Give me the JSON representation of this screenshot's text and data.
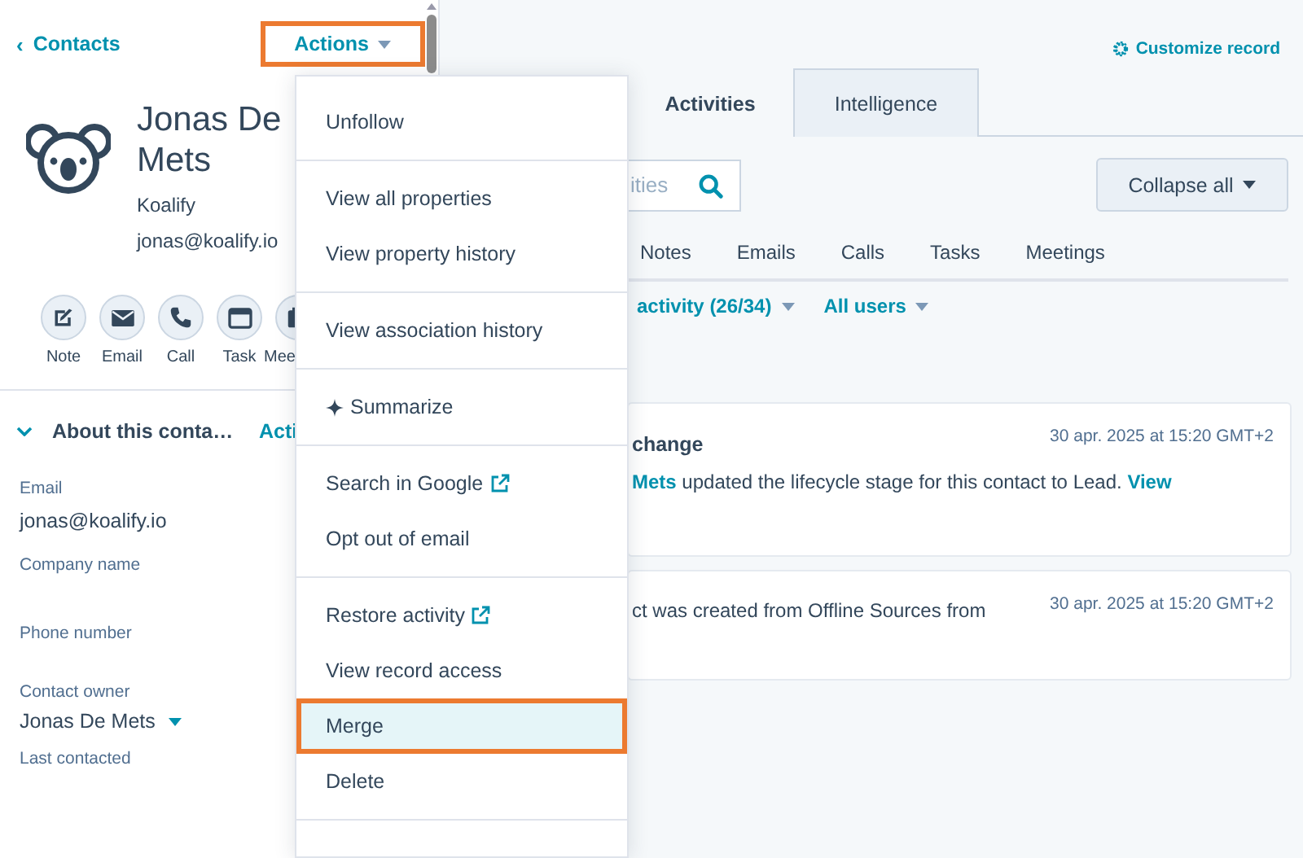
{
  "back_link": {
    "icon": "‹",
    "label": "Contacts"
  },
  "actions_button": {
    "label": "Actions",
    "outlined": true
  },
  "contact": {
    "name": "Jonas De Mets",
    "company": "Koalify",
    "email": "jonas@koalify.io"
  },
  "quick_actions": [
    {
      "kind": "note",
      "label": "Note"
    },
    {
      "kind": "email",
      "label": "Email"
    },
    {
      "kind": "call",
      "label": "Call"
    },
    {
      "kind": "task",
      "label": "Task"
    },
    {
      "kind": "meeting",
      "label": "Mee"
    }
  ],
  "about_section": {
    "title": "About this conta…",
    "expanded": true,
    "action": "Acti"
  },
  "fields": [
    {
      "label": "Email",
      "value": "jonas@koalify.io",
      "kind": "text"
    },
    {
      "label": "Company name",
      "kind": "text"
    },
    {
      "label": "Phone number",
      "kind": "text"
    },
    {
      "label": "Contact owner",
      "value": "Jonas De Mets",
      "kind": "dropdown"
    },
    {
      "label": "Last contacted",
      "kind": "text"
    }
  ],
  "menu": {
    "groups": [
      [
        {
          "label": "Unfollow",
          "kind": "plain",
          "selected": false,
          "outlined": false
        }
      ],
      [
        {
          "label": "View all properties",
          "kind": "plain",
          "selected": false,
          "outlined": false
        },
        {
          "label": "View property history",
          "kind": "plain",
          "selected": false,
          "outlined": false
        }
      ],
      [
        {
          "label": "View association history",
          "kind": "plain",
          "selected": false,
          "outlined": false
        }
      ],
      [
        {
          "label": "Summarize",
          "kind": "ai",
          "selected": false,
          "outlined": false
        }
      ],
      [
        {
          "label": "Search in Google",
          "kind": "external",
          "selected": false,
          "outlined": false
        },
        {
          "label": "Opt out of email",
          "kind": "plain",
          "selected": false,
          "outlined": false
        }
      ],
      [
        {
          "label": "Restore activity",
          "kind": "external",
          "selected": false,
          "outlined": false
        },
        {
          "label": "View record access",
          "kind": "plain",
          "selected": false,
          "outlined": false
        },
        {
          "label": "Merge",
          "kind": "plain",
          "selected": true,
          "outlined": true
        },
        {
          "label": "Delete",
          "kind": "plain",
          "selected": false,
          "outlined": false
        }
      ]
    ]
  },
  "customize_link": "Customize record",
  "tabs": [
    {
      "label": "Activities",
      "selected": true
    },
    {
      "label": "Intelligence",
      "selected": false
    }
  ],
  "search": {
    "placeholder": "ities"
  },
  "collapse_button": "Collapse all",
  "activity_filters": [
    "Notes",
    "Emails",
    "Calls",
    "Tasks",
    "Meetings"
  ],
  "filter_dropdowns": [
    "activity (26/34)",
    "All users"
  ],
  "cards": [
    {
      "title": "change",
      "date": "30 apr. 2025 at 15:20 GMT+2",
      "body": [
        {
          "kind": "link",
          "text": "Mets"
        },
        {
          "kind": "text",
          "text": " updated the lifecycle stage for this contact to Lead. "
        },
        {
          "kind": "link",
          "text": "View"
        }
      ]
    },
    {
      "date": "30 apr. 2025 at 15:20 GMT+2",
      "body": [
        {
          "kind": "text",
          "text": "ct was created from Offline Sources from"
        }
      ]
    }
  ]
}
